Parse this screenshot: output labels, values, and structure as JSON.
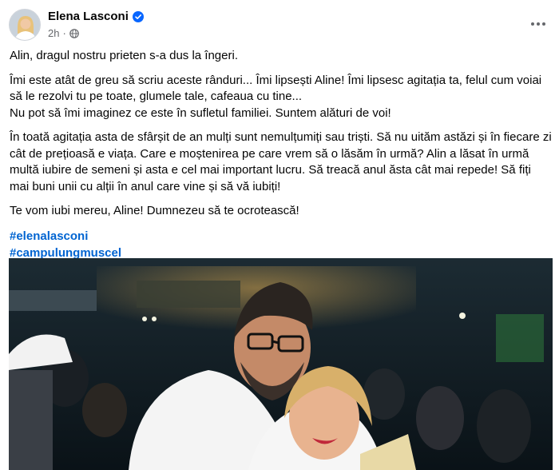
{
  "post": {
    "author": "Elena Lasconi",
    "time": "2h",
    "paragraphs": [
      "Alin, dragul nostru prieten s-a dus la îngeri.",
      "Îmi este atât de greu să scriu aceste rânduri... Îmi lipsești Aline! Îmi lipsesc agitația ta, felul cum voiai să le rezolvi tu pe toate, glumele tale, cafeaua cu tine...\nNu pot să îmi imaginez ce este în sufletul familiei. Suntem alături de voi!",
      "În toată agitația asta de sfârșit de an mulți sunt nemulțumiți sau triști. Să nu uităm astăzi și în fiecare zi cât de prețioasă e viața. Care e moștenirea pe care vrem să o lăsăm în urmă? Alin a lăsat în urmă multă iubire de semeni și asta e cel mai important lucru. Să treacă anul ăsta cât mai repede! Să fiți mai buni unii cu alții în anul care vine și să vă iubiți!",
      "Te vom iubi mereu, Aline! Dumnezeu să te ocrotească!"
    ],
    "hashtags": [
      "#elenalasconi",
      "#campulungmuscel"
    ]
  },
  "icons": {
    "verified": "verified-badge-icon",
    "audience": "globe-icon",
    "more": "more-options-icon"
  },
  "colors": {
    "verified": "#0866ff",
    "hashtag": "#0064d1",
    "meta": "#65676b"
  }
}
